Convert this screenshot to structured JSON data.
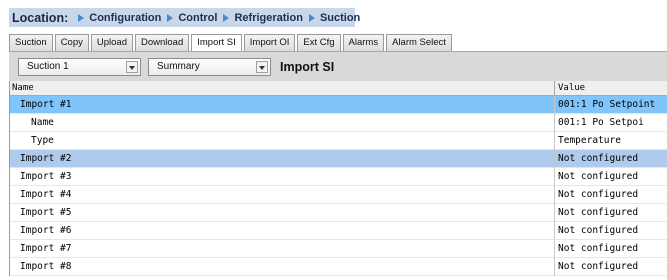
{
  "breadcrumb": {
    "label": "Location:",
    "items": [
      "Configuration",
      "Control",
      "Refrigeration",
      "Suction"
    ]
  },
  "tabs": [
    "Suction",
    "Copy",
    "Upload",
    "Download",
    "Import SI",
    "Import OI",
    "Ext Cfg",
    "Alarms",
    "Alarm Select"
  ],
  "active_tab": "Import SI",
  "toolbar": {
    "select1": "Suction 1",
    "select2": "Summary",
    "title": "Import SI"
  },
  "table": {
    "headers": {
      "name": "Name",
      "value": "Value"
    },
    "rows": [
      {
        "name": "Import #1",
        "value": "001:1 Po Setpoint"
      },
      {
        "name": "Name",
        "value": "001:1 Po Setpoi"
      },
      {
        "name": "Type",
        "value": "Temperature"
      },
      {
        "name": "Import #2",
        "value": "Not configured"
      },
      {
        "name": "Import #3",
        "value": "Not configured"
      },
      {
        "name": "Import #4",
        "value": "Not configured"
      },
      {
        "name": "Import #5",
        "value": "Not configured"
      },
      {
        "name": "Import #6",
        "value": "Not configured"
      },
      {
        "name": "Import #7",
        "value": "Not configured"
      },
      {
        "name": "Import #8",
        "value": "Not configured"
      }
    ]
  },
  "colors": {
    "selected_row": "#7fc4fa",
    "highlight_row": "#aecbee",
    "breadcrumb_bg": "#c9d7ea",
    "breadcrumb_arrow": "#4d88c8"
  }
}
